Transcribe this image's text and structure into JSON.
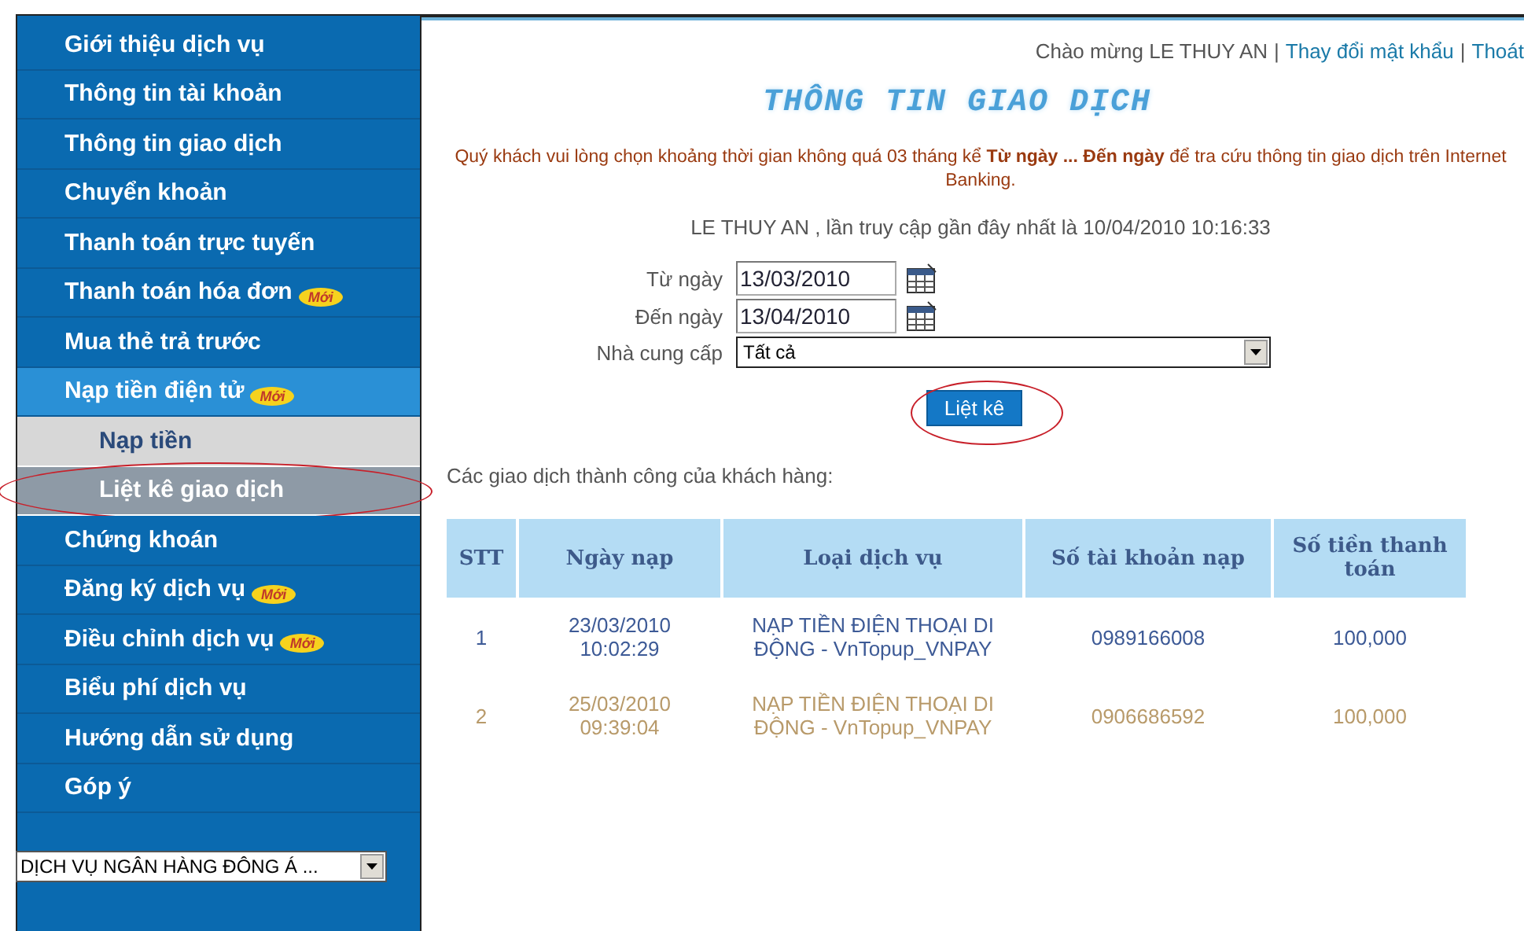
{
  "menu": [
    {
      "label": "Giới thiệu dịch vụ",
      "kind": "main",
      "expanded": false,
      "selected": false,
      "circled": false
    },
    {
      "label": "Thông tin tài khoản",
      "kind": "main",
      "expanded": false,
      "selected": false,
      "circled": false
    },
    {
      "label": "Thông tin giao dịch",
      "kind": "main",
      "expanded": false,
      "selected": false,
      "circled": false
    },
    {
      "label": "Chuyển khoản",
      "kind": "main",
      "expanded": false,
      "selected": false,
      "circled": false
    },
    {
      "label": "Thanh toán trực tuyến",
      "kind": "main",
      "expanded": false,
      "selected": false,
      "circled": false
    },
    {
      "label": "Thanh toán hóa đơn",
      "kind": "main",
      "badge": "Mới",
      "expanded": false,
      "selected": false,
      "circled": false
    },
    {
      "label": "Mua thẻ trả trước",
      "kind": "main",
      "expanded": false,
      "selected": false,
      "circled": false
    },
    {
      "label": "Nạp tiền điện tử",
      "kind": "main",
      "badge": "Mới",
      "expanded": true,
      "selected": false,
      "circled": false
    },
    {
      "label": "Nạp tiền",
      "kind": "sub",
      "selected": false,
      "circled": false
    },
    {
      "label": "Liệt kê giao dịch",
      "kind": "sub",
      "selected": true,
      "circled": true
    },
    {
      "label": "Chứng khoán",
      "kind": "main",
      "expanded": false,
      "selected": false,
      "circled": false
    },
    {
      "label": "Đăng ký dịch vụ",
      "kind": "main",
      "badge": "Mới",
      "expanded": false,
      "selected": false,
      "circled": false
    },
    {
      "label": "Điều chỉnh dịch vụ",
      "kind": "main",
      "badge": "Mới",
      "expanded": false,
      "selected": false,
      "circled": false
    },
    {
      "label": "Biểu phí dịch vụ",
      "kind": "main",
      "expanded": false,
      "selected": false,
      "circled": false
    },
    {
      "label": "Hướng dẫn sử dụng",
      "kind": "main",
      "expanded": false,
      "selected": false,
      "circled": false
    },
    {
      "label": "Góp ý",
      "kind": "main",
      "expanded": false,
      "selected": false,
      "circled": false
    }
  ],
  "sidebar_select": {
    "value": "DỊCH VỤ NGÂN HÀNG ĐÔNG Á ..."
  },
  "header": {
    "greeting": "Chào mừng LE THUY AN",
    "separator_1": "|",
    "change_password": "Thay đổi mật khẩu",
    "separator_2": "|",
    "logout": "Thoát"
  },
  "title": "THÔNG TIN GIAO DỊCH",
  "notice": "Quý khách vui lòng chọn khoảng thời gian không quá 03 tháng kể **Từ ngày ... Đến ngày** để tra cứu thông tin giao dịch trên Internet Banking.",
  "last_access": "LE THUY AN , lần truy cập gần đây nhất là 10/04/2010 10:16:33",
  "form": {
    "from_label": "Từ ngày",
    "from_value": "13/03/2010",
    "to_label": "Đến ngày",
    "to_value": "13/04/2010",
    "provider_label": "Nhà cung cấp",
    "provider_value": "Tất cả"
  },
  "submit": {
    "label": "Liệt kê",
    "circled": true
  },
  "result_caption": "Các giao dịch thành công của khách hàng:",
  "table": {
    "columns": [
      "STT",
      "Ngày nạp",
      "Loại dịch vụ",
      "Số tài khoản nạp",
      "Số tiền thanh toán"
    ],
    "rows": [
      {
        "color": "#3d5a96",
        "cells": [
          "1",
          "23/03/2010 10:02:29",
          "NẠP TIỀN ĐIỆN THOẠI DI ĐỘNG - VnTopup_VNPAY",
          "0989166008",
          "100,000"
        ]
      },
      {
        "color": "#b89a6a",
        "cells": [
          "2",
          "25/03/2010 09:39:04",
          "NẠP TIỀN ĐIỆN THOẠI DI ĐỘNG - VnTopup_VNPAY",
          "0906686592",
          "100,000"
        ]
      }
    ]
  }
}
